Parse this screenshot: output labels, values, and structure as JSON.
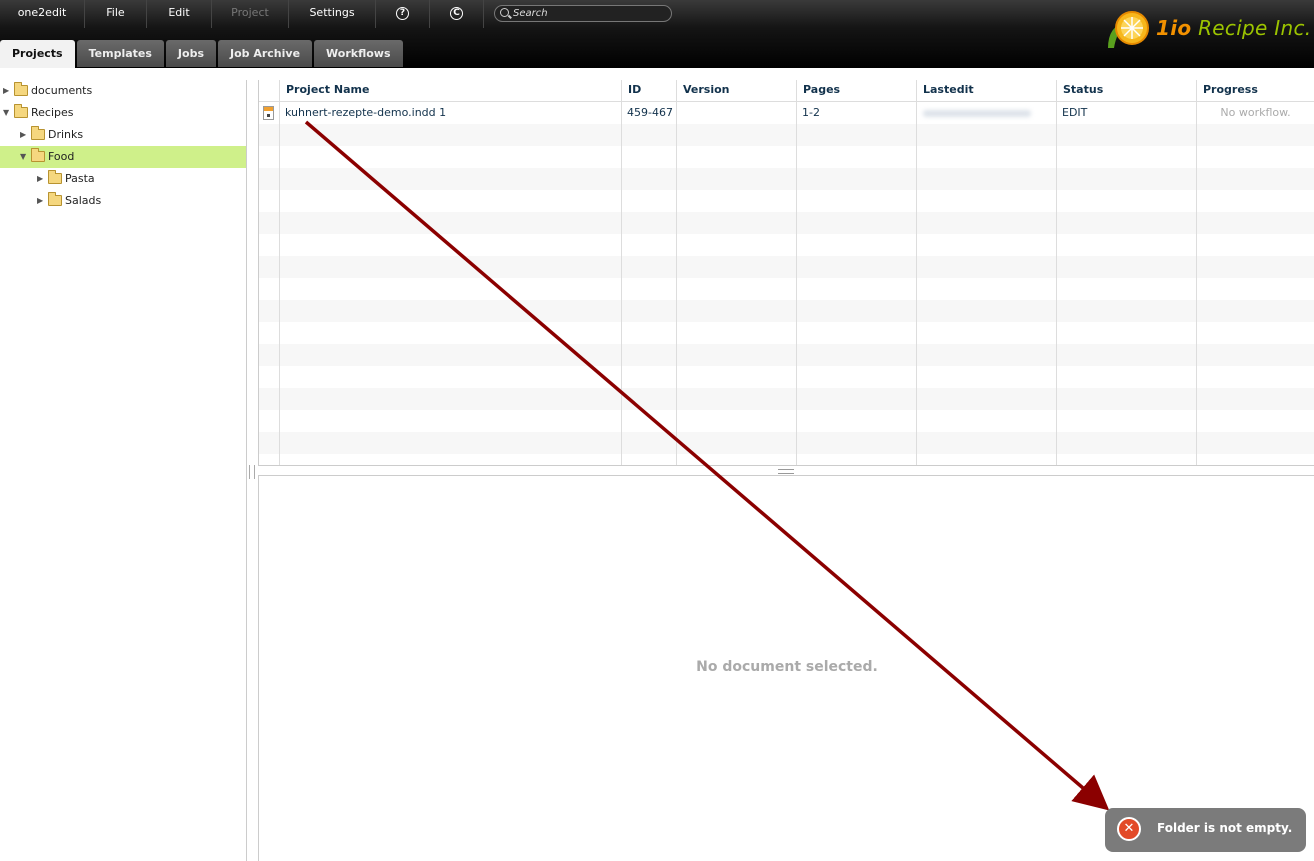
{
  "menu": {
    "app": "one2edit",
    "file": "File",
    "edit": "Edit",
    "project": "Project",
    "settings": "Settings",
    "help_icon": "?",
    "copyright_icon": "C"
  },
  "search": {
    "placeholder": "Search"
  },
  "brand": {
    "num": "1io",
    "name": "Recipe Inc."
  },
  "tabs": [
    "Projects",
    "Templates",
    "Jobs",
    "Job Archive",
    "Workflows"
  ],
  "tree": {
    "items": [
      {
        "label": "documents",
        "expanded": false
      },
      {
        "label": "Recipes",
        "expanded": true
      },
      {
        "label": "Drinks",
        "expanded": false
      },
      {
        "label": "Food",
        "expanded": true,
        "selected": true
      },
      {
        "label": "Pasta",
        "expanded": false
      },
      {
        "label": "Salads",
        "expanded": false
      }
    ]
  },
  "table": {
    "columns": [
      "Project Name",
      "ID",
      "Version",
      "Pages",
      "Lastedit",
      "Status",
      "Progress"
    ],
    "rows": [
      {
        "project_name": "kuhnert-rezepte-demo.indd 1",
        "id": "459-467",
        "version": "",
        "pages": "1-2",
        "lastedit": "",
        "status": "EDIT",
        "progress": "No workflow."
      }
    ]
  },
  "detail": {
    "empty_message": "No document selected."
  },
  "toast": {
    "message": "Folder is not empty.",
    "icon": "close-icon",
    "color": "#e24a28"
  },
  "colors": {
    "selected_tree": "#cff08a",
    "arrow": "#8b0000",
    "brand_green": "#9cc400",
    "brand_orange": "#f29100"
  }
}
